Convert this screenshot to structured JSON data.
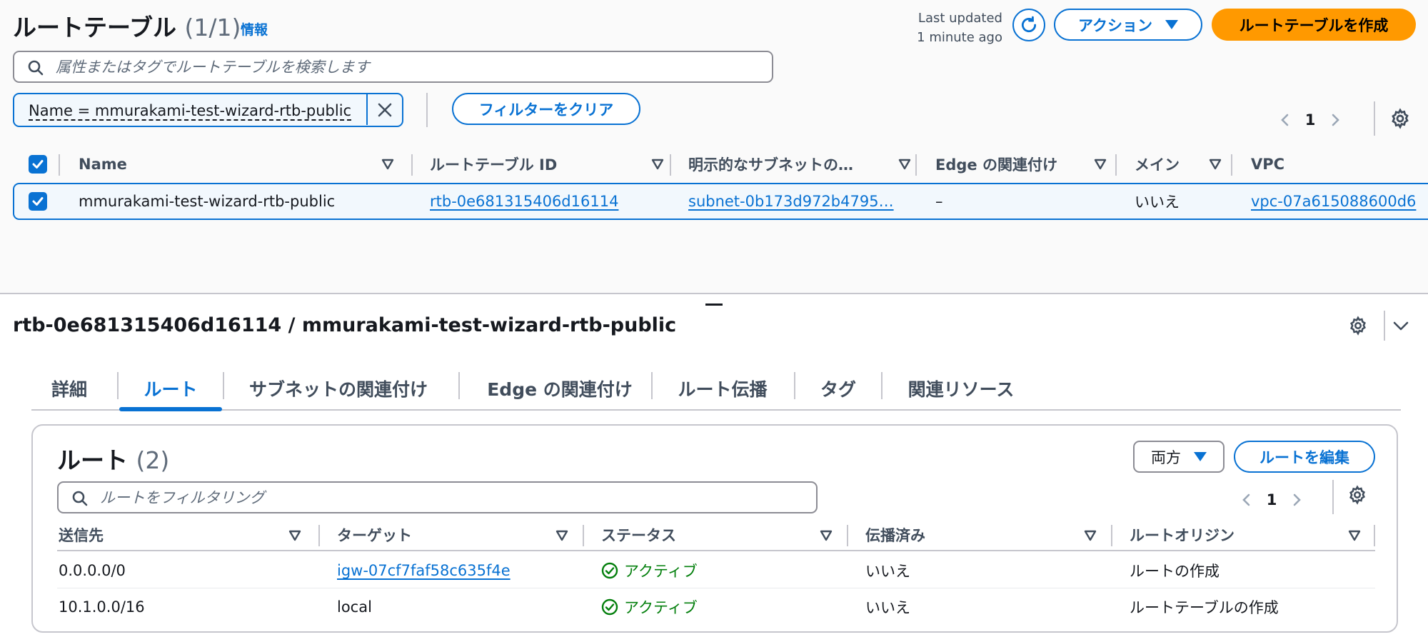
{
  "header": {
    "title": "ルートテーブル",
    "count": "(1/1)",
    "info_link": "情報",
    "last_updated_line1": "Last updated",
    "last_updated_line2": "1 minute ago",
    "actions_label": "アクション",
    "create_label": "ルートテーブルを作成"
  },
  "search": {
    "placeholder": "属性またはタグでルートテーブルを検索します"
  },
  "filter": {
    "token_label": "Name = mmurakami-test-wizard-rtb-public",
    "clear_label": "フィルターをクリア"
  },
  "table_pager": {
    "page": "1"
  },
  "table": {
    "columns": [
      "Name",
      "ルートテーブル ID",
      "明示的なサブネットの…",
      "Edge の関連付け",
      "メイン",
      "VPC"
    ],
    "rows": [
      {
        "name": "mmurakami-test-wizard-rtb-public",
        "route_table_id": "rtb-0e681315406d16114",
        "subnet": "subnet-0b173d972b4795…",
        "edge": "–",
        "main": "いいえ",
        "vpc": "vpc-07a615088600d6"
      }
    ]
  },
  "detail": {
    "title": "rtb-0e681315406d16114 / mmurakami-test-wizard-rtb-public",
    "tabs": [
      "詳細",
      "ルート",
      "サブネットの関連付け",
      "Edge の関連付け",
      "ルート伝播",
      "タグ",
      "関連リソース"
    ],
    "active_tab": "ルート"
  },
  "routes": {
    "title": "ルート",
    "count": "(2)",
    "direction_label": "両方",
    "edit_label": "ルートを編集",
    "filter_placeholder": "ルートをフィルタリング",
    "page": "1",
    "columns": [
      "送信先",
      "ターゲット",
      "ステータス",
      "伝播済み",
      "ルートオリジン"
    ],
    "rows": [
      {
        "destination": "0.0.0.0/0",
        "target": "igw-07cf7faf58c635f4e",
        "status": "アクティブ",
        "propagated": "いいえ",
        "origin": "ルートの作成"
      },
      {
        "destination": "10.1.0.0/16",
        "target": "local",
        "status": "アクティブ",
        "propagated": "いいえ",
        "origin": "ルートテーブルの作成"
      }
    ]
  },
  "colors": {
    "accent": "#0972d3",
    "primary_button": "#ff9900",
    "status_ok": "#037f0c",
    "selected_row_bg": "#f2f8fd"
  },
  "icons": [
    "refresh-icon",
    "caret-down-icon",
    "search-icon",
    "close-icon",
    "chevron-left-icon",
    "chevron-right-icon",
    "gear-icon",
    "sort-icon",
    "checkbox-checked-icon",
    "chevron-down-icon",
    "status-success-icon"
  ]
}
